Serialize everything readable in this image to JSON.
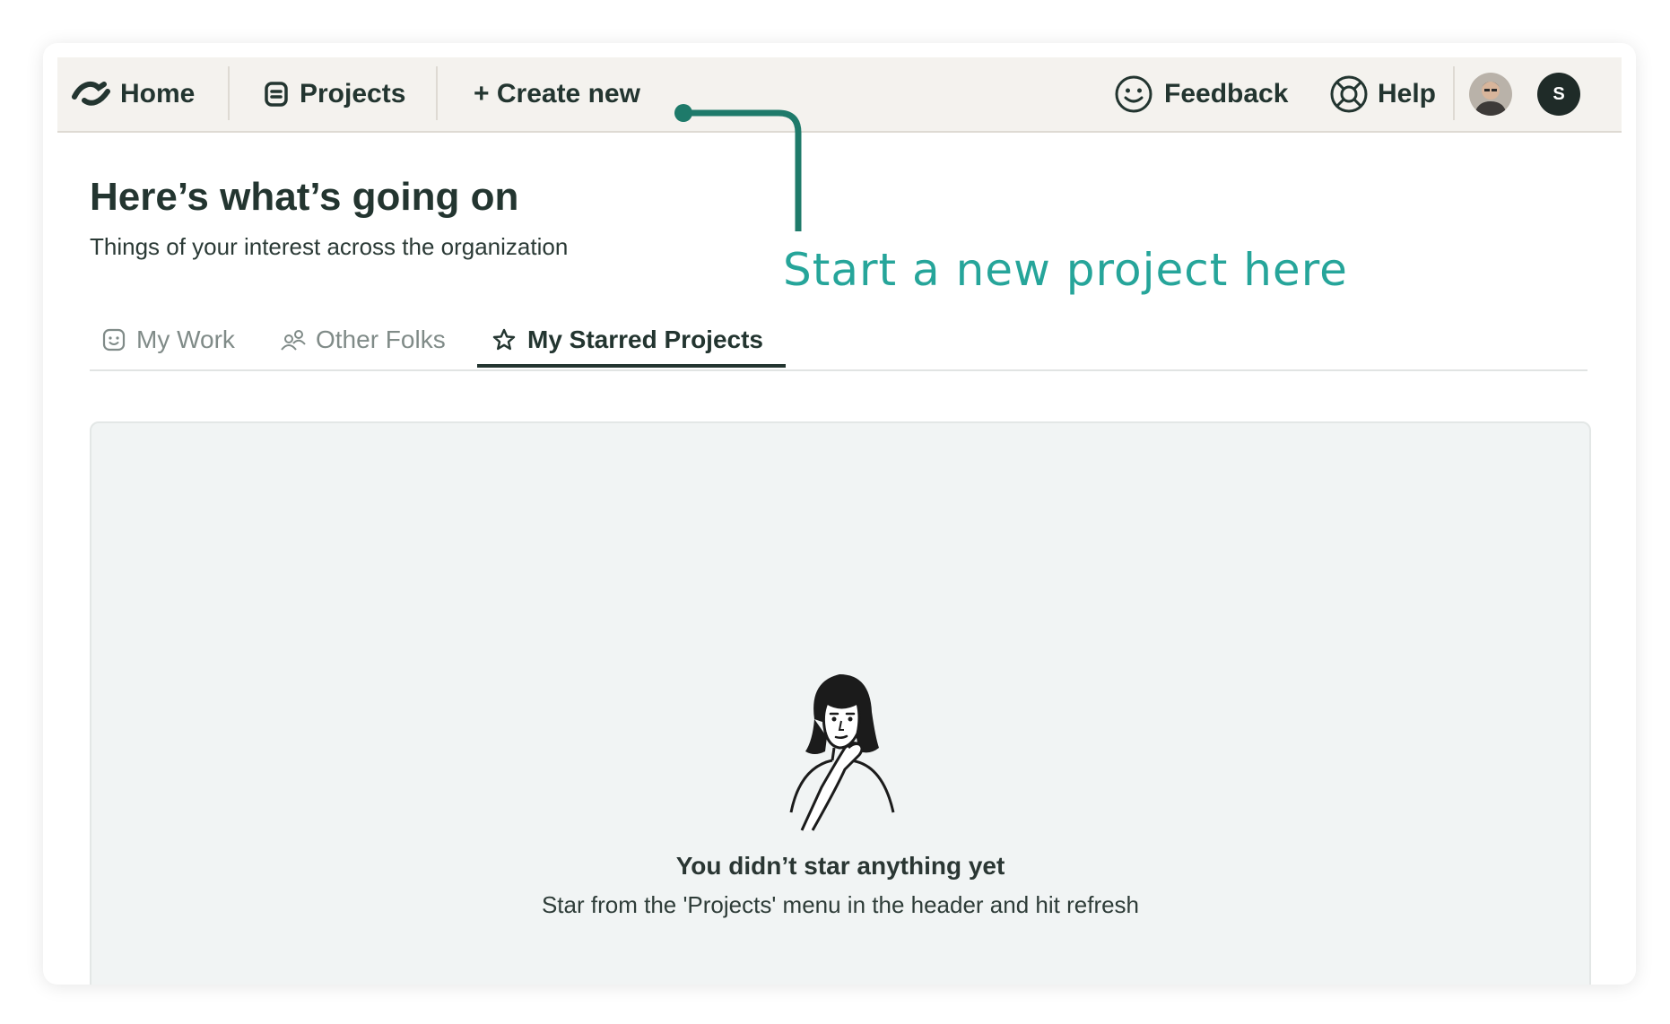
{
  "nav": {
    "home_label": "Home",
    "projects_label": "Projects",
    "create_label": "+ Create new",
    "feedback_label": "Feedback",
    "help_label": "Help",
    "user_initial": "S"
  },
  "header": {
    "title": "Here’s what’s going on",
    "subtitle": "Things of your interest across the organization"
  },
  "annotation": {
    "text": "Start a new project here",
    "color": "#26a59a",
    "pointer_color": "#1e7a6a"
  },
  "tabs": [
    {
      "label": "My Work",
      "icon": "smiley-square-icon",
      "active": false
    },
    {
      "label": "Other Folks",
      "icon": "people-icon",
      "active": false
    },
    {
      "label": "My Starred Projects",
      "icon": "star-icon",
      "active": true
    }
  ],
  "empty_state": {
    "title": "You didn’t star anything yet",
    "description": "Star from the 'Projects' menu in the header and hit refresh",
    "illustration": "thinking-woman-illustration"
  },
  "colors": {
    "navbar_bg": "#f4f2ee",
    "text_dark": "#233530",
    "panel_bg": "#f1f4f4"
  }
}
